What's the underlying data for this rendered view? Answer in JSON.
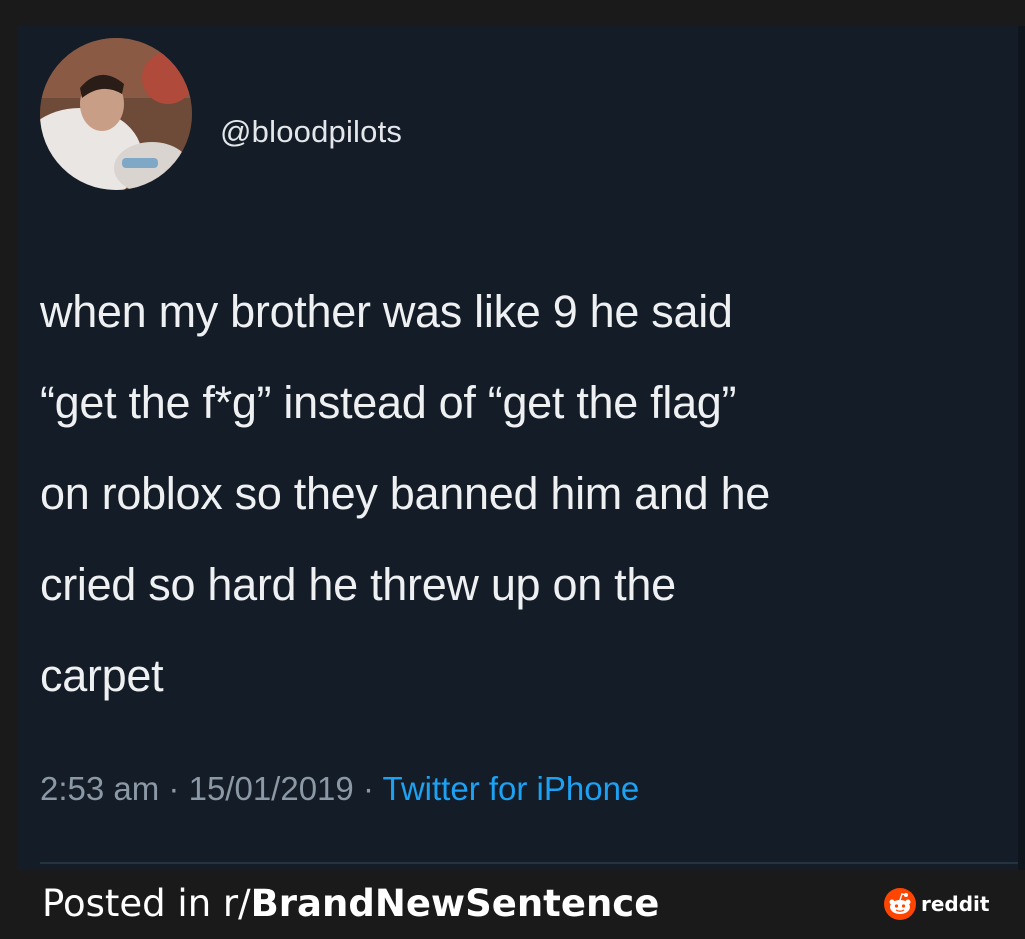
{
  "tweet": {
    "handle": "@bloodpilots",
    "text_lines": [
      "when my brother was like 9 he said",
      "“get the f*g” instead of “get the flag”",
      "on roblox so they banned him and he",
      "cried so hard he threw up on the",
      "carpet"
    ],
    "time": "2:53 am",
    "separator": "·",
    "date": "15/01/2019",
    "source": "Twitter for iPhone",
    "avatar_icon": "profile-photo"
  },
  "footer": {
    "posted_prefix": "Posted in r/",
    "subreddit": "BrandNewSentence",
    "brand_icon": "reddit-alien-icon",
    "brand_label": "reddit"
  },
  "colors": {
    "tweet_bg": "#131c27",
    "text": "#eef0f2",
    "meta": "#8b98a5",
    "link": "#1da1f2",
    "reddit_orange": "#ff4500",
    "frame_bg": "#1a1a1a"
  }
}
